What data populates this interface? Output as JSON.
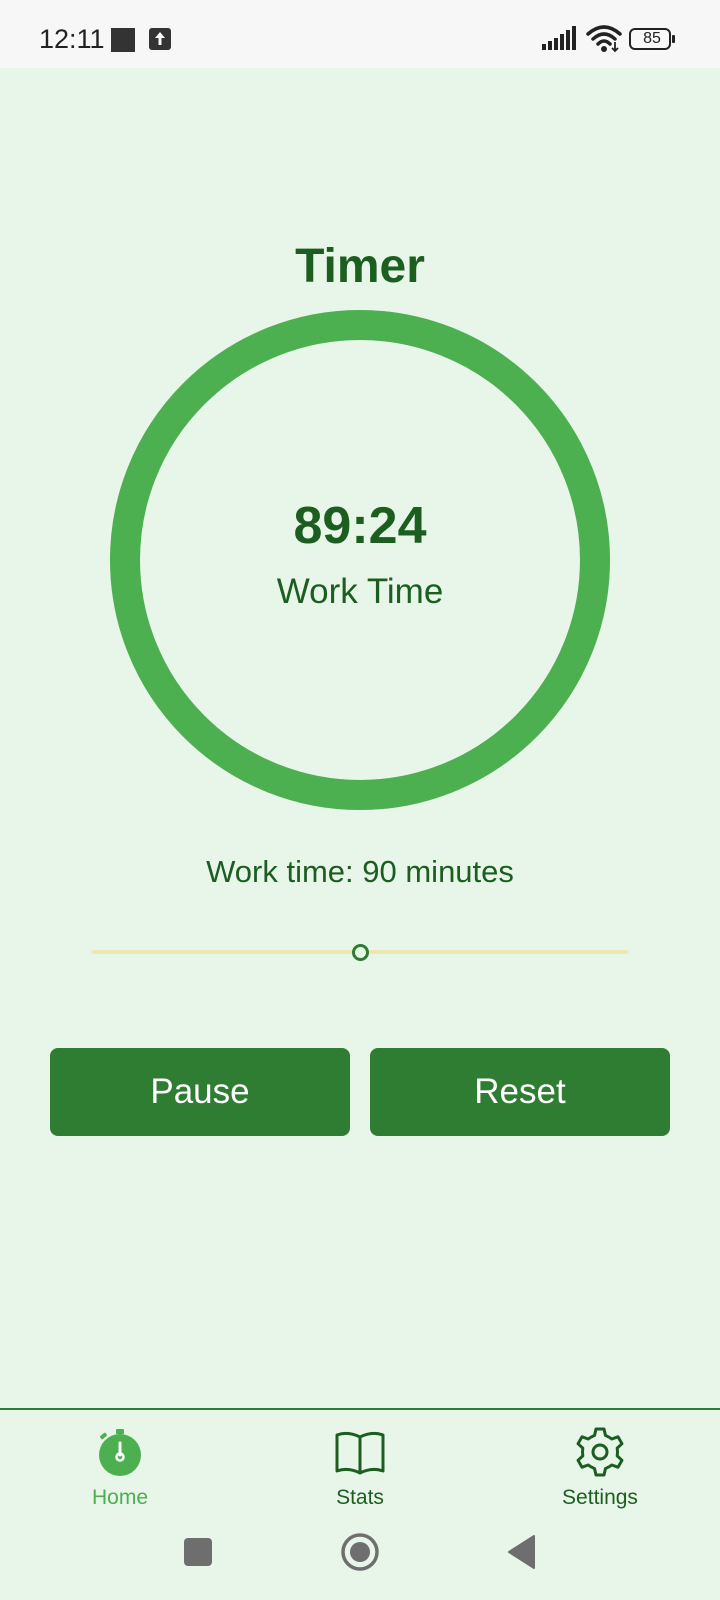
{
  "status_bar": {
    "time": "12:11",
    "battery_level": "85",
    "icons": [
      "notification-square-icon",
      "upload-icon",
      "signal-icon",
      "wifi-icon",
      "battery-icon"
    ]
  },
  "timer": {
    "title": "Timer",
    "time_display": "89:24",
    "mode_label": "Work Time",
    "progress_fraction": 1.0,
    "ring_color": "#4caf50"
  },
  "duration": {
    "label": "Work time: 90 minutes",
    "slider_fraction": 0.5
  },
  "buttons": {
    "pause_label": "Pause",
    "reset_label": "Reset"
  },
  "bottom_nav": {
    "items": [
      {
        "label": "Home",
        "icon": "stopwatch-icon",
        "active": true
      },
      {
        "label": "Stats",
        "icon": "book-icon",
        "active": false
      },
      {
        "label": "Settings",
        "icon": "gear-icon",
        "active": false
      }
    ]
  },
  "system_nav": {
    "icons": [
      "recents-square-icon",
      "home-circle-icon",
      "back-triangle-icon"
    ]
  },
  "colors": {
    "background": "#e8f5e9",
    "primary_dark": "#1b5e20",
    "button": "#2e7d32",
    "accent": "#4caf50",
    "slider_track": "#ede7b0"
  }
}
